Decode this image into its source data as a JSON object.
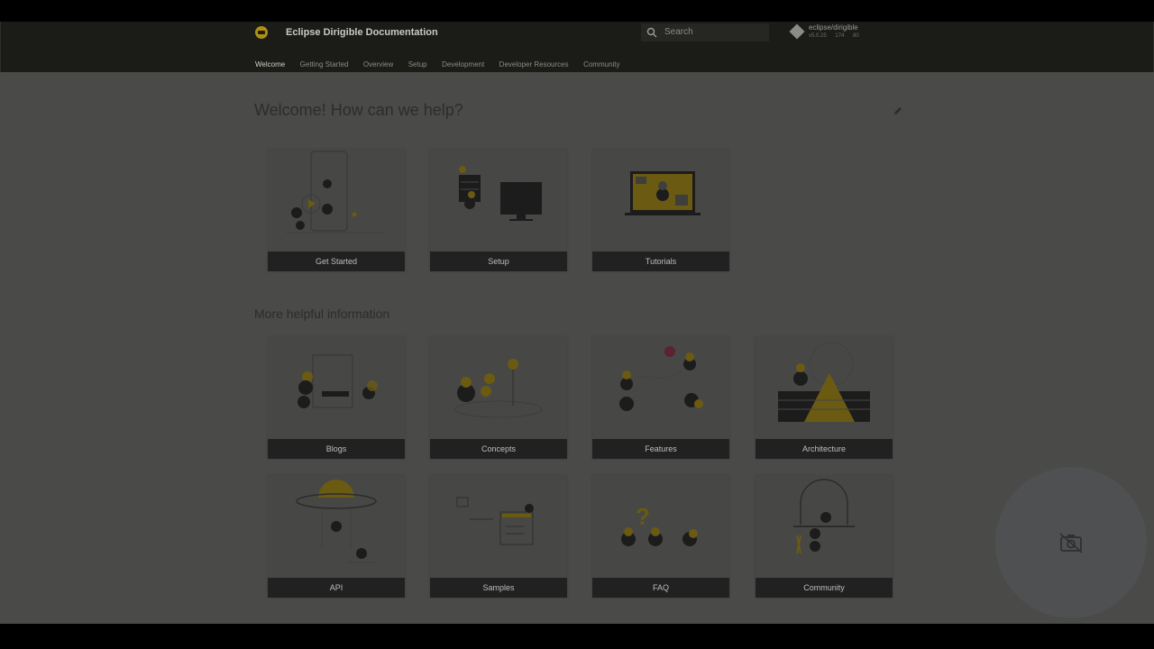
{
  "header": {
    "title": "Eclipse Dirigible Documentation",
    "search_placeholder": "Search",
    "repo": {
      "name": "eclipse/dirigible",
      "version": "v5.0.25",
      "stars": "174",
      "forks": "80"
    }
  },
  "nav": [
    "Welcome",
    "Getting Started",
    "Overview",
    "Setup",
    "Development",
    "Developer Resources",
    "Community"
  ],
  "main": {
    "welcome_title": "Welcome! How can we help?",
    "more_title": "More helpful information",
    "cards_primary": [
      {
        "label": "Get Started",
        "icon": "get-started-illustration"
      },
      {
        "label": "Setup",
        "icon": "setup-illustration"
      },
      {
        "label": "Tutorials",
        "icon": "tutorials-illustration"
      }
    ],
    "cards_more": [
      {
        "label": "Blogs",
        "icon": "blogs-illustration"
      },
      {
        "label": "Concepts",
        "icon": "concepts-illustration"
      },
      {
        "label": "Features",
        "icon": "features-illustration"
      },
      {
        "label": "Architecture",
        "icon": "architecture-illustration"
      },
      {
        "label": "API",
        "icon": "api-illustration"
      },
      {
        "label": "Samples",
        "icon": "samples-illustration"
      },
      {
        "label": "FAQ",
        "icon": "faq-illustration"
      },
      {
        "label": "Community",
        "icon": "community-illustration"
      }
    ]
  },
  "overlay": {
    "icon": "camera-off-icon"
  },
  "colors": {
    "accent": "#b08f0f",
    "header_bg": "#1b1b17",
    "content_bg": "#4a4a49",
    "card_label_bg": "#212121"
  }
}
